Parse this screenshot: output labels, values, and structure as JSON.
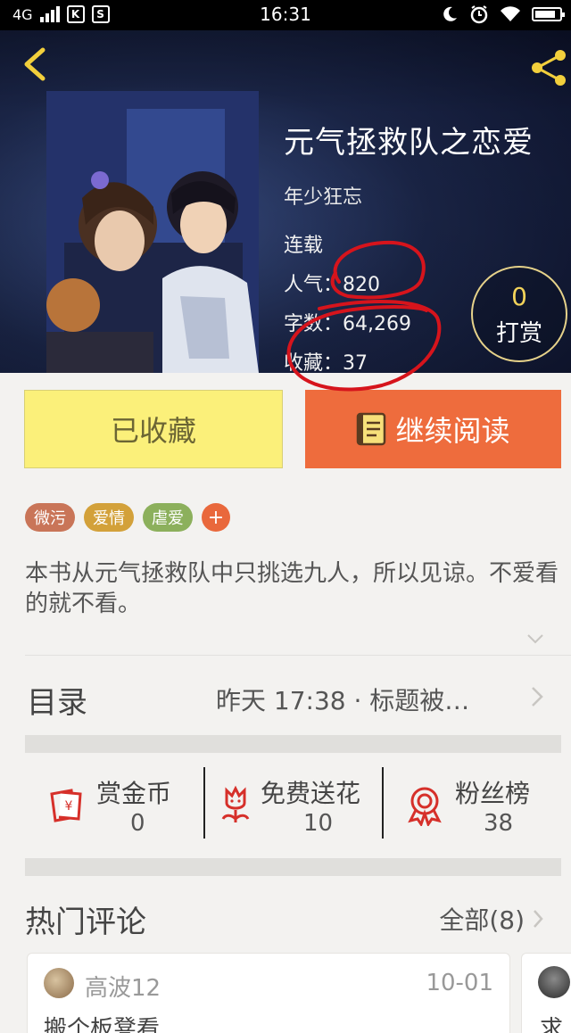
{
  "status_bar": {
    "network": "4G",
    "time": "16:31",
    "app_icon_1": "K",
    "app_icon_2": "S"
  },
  "header": {
    "back_icon": "chevron-left-icon",
    "share_icon": "share-icon"
  },
  "book": {
    "title": "元气拯救队之恋爱",
    "author": "年少狂忘",
    "status": "连载",
    "popularity_label": "人气：",
    "popularity": "820",
    "words_label": "字数：",
    "words": "64,269",
    "favorites_label": "收藏：",
    "favorites": "37"
  },
  "reward": {
    "count": "0",
    "label": "打赏"
  },
  "actions": {
    "favorited_label": "已收藏",
    "continue_label": "继续阅读"
  },
  "tags": [
    {
      "label": "微污",
      "color": "#c97558"
    },
    {
      "label": "爱情",
      "color": "#d3a13a"
    },
    {
      "label": "虐爱",
      "color": "#8cb05c"
    }
  ],
  "tag_add": "+",
  "description": "本书从元气拯救队中只挑选九人，所以见谅。不爱看的就不看。",
  "toc": {
    "title": "目录",
    "update": "昨天 17:38 · 标题被…"
  },
  "stats": [
    {
      "label": "赏金币",
      "value": "0"
    },
    {
      "label": "免费送花",
      "value": "10"
    },
    {
      "label": "粉丝榜",
      "value": "38"
    }
  ],
  "hot_comments": {
    "title": "热门评论",
    "all_label": "全部(8)",
    "items": [
      {
        "user": "高波12",
        "date": "10-01",
        "text": "搬个板凳看"
      },
      {
        "text": "求"
      }
    ]
  },
  "colors": {
    "accent_orange": "#ee6c3d",
    "fav_yellow": "#fbf07a",
    "annotation_red": "#d6141c"
  }
}
